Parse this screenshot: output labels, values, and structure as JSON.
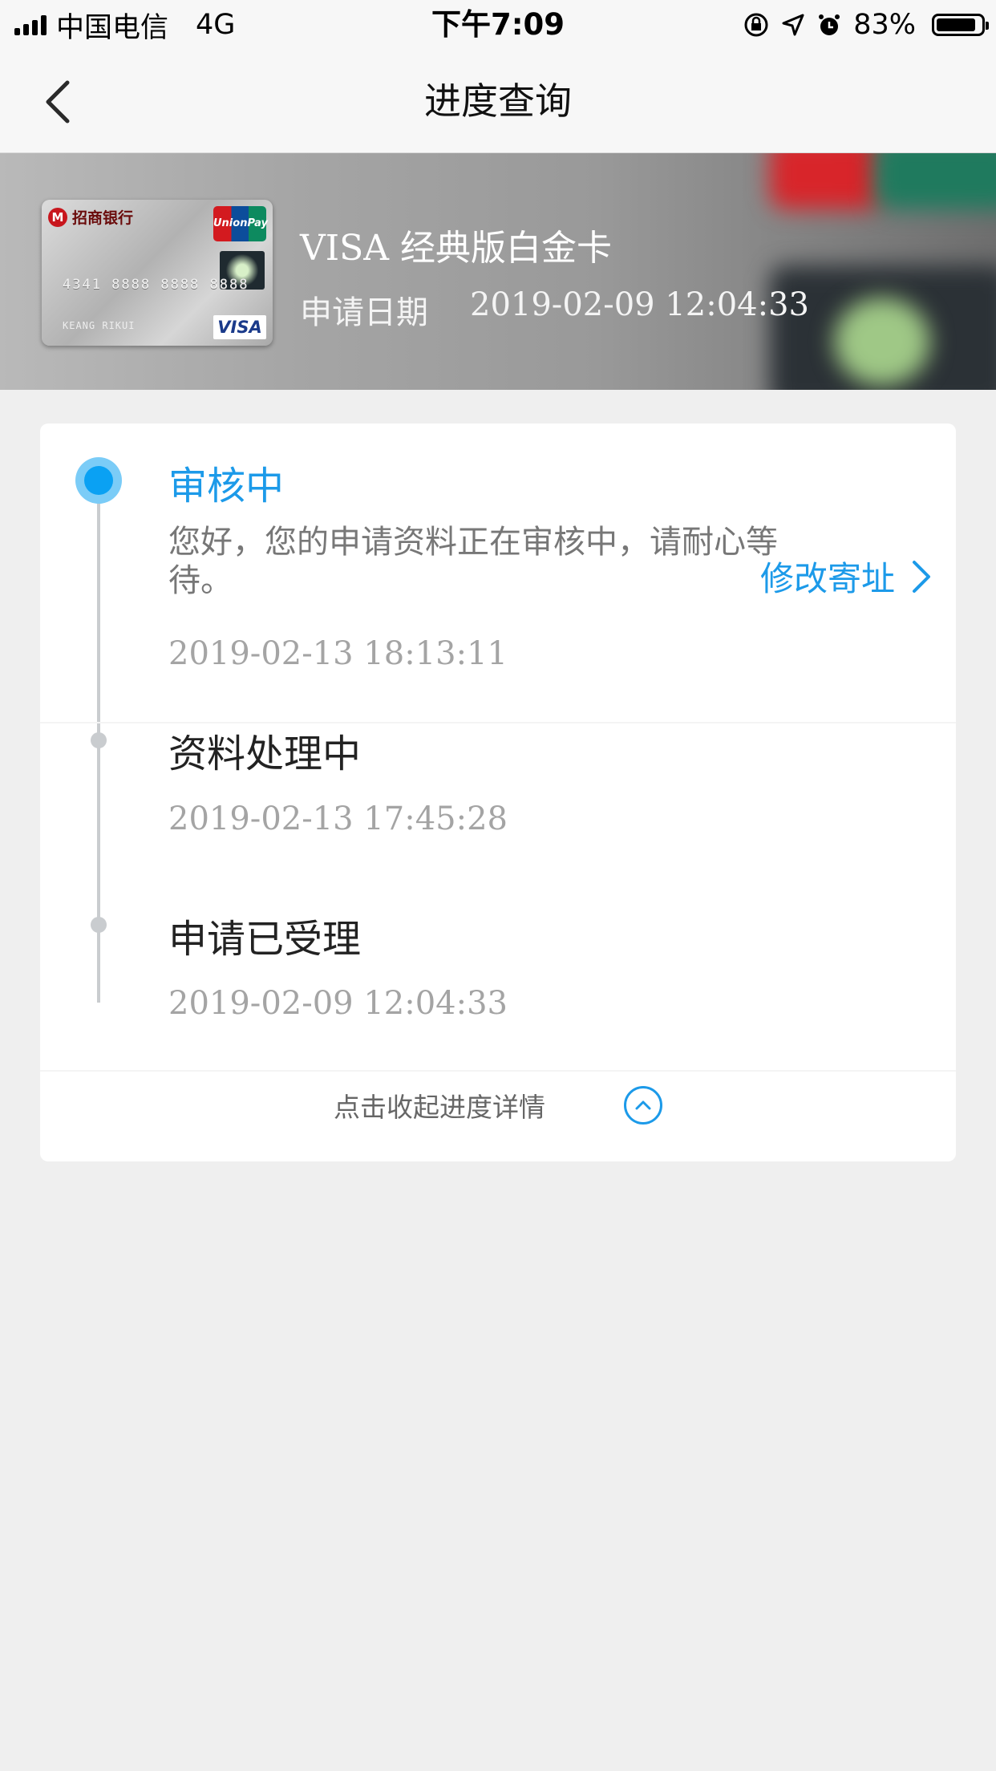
{
  "status_bar": {
    "carrier": "中国电信",
    "network": "4G",
    "time": "下午7:09",
    "battery": "83%",
    "icons": [
      "signal-icon",
      "rotation-lock-icon",
      "location-icon",
      "alarm-icon",
      "battery-icon"
    ]
  },
  "nav": {
    "title": "进度查询",
    "back_icon": "chevron-left-icon"
  },
  "card_info": {
    "card_name": "VISA 经典版白金卡",
    "apply_label": "申请日期",
    "apply_date": "2019-02-09 12:04:33",
    "card_image": {
      "bank_name": "招商银行",
      "unionpay_text": "UnionPay",
      "number": "4341 8888 8888 8888",
      "holder": "KEANG RIKUI",
      "network_logo": "VISA"
    }
  },
  "progress": {
    "steps": [
      {
        "title": "审核中",
        "description": "您好，您的申请资料正在审核中，请耐心等待。",
        "time": "2019-02-13 18:13:11",
        "active": true
      },
      {
        "title": "资料处理中",
        "time": "2019-02-13 17:45:28",
        "active": false
      },
      {
        "title": "申请已受理",
        "time": "2019-02-09 12:04:33",
        "active": false
      }
    ],
    "modify_address_label": "修改寄址",
    "collapse_label": "点击收起进度详情"
  },
  "colors": {
    "accent": "#1c9ae9",
    "active_dot": "#0aa1f3",
    "background": "#efefef",
    "timeline": "#c9cccf"
  }
}
